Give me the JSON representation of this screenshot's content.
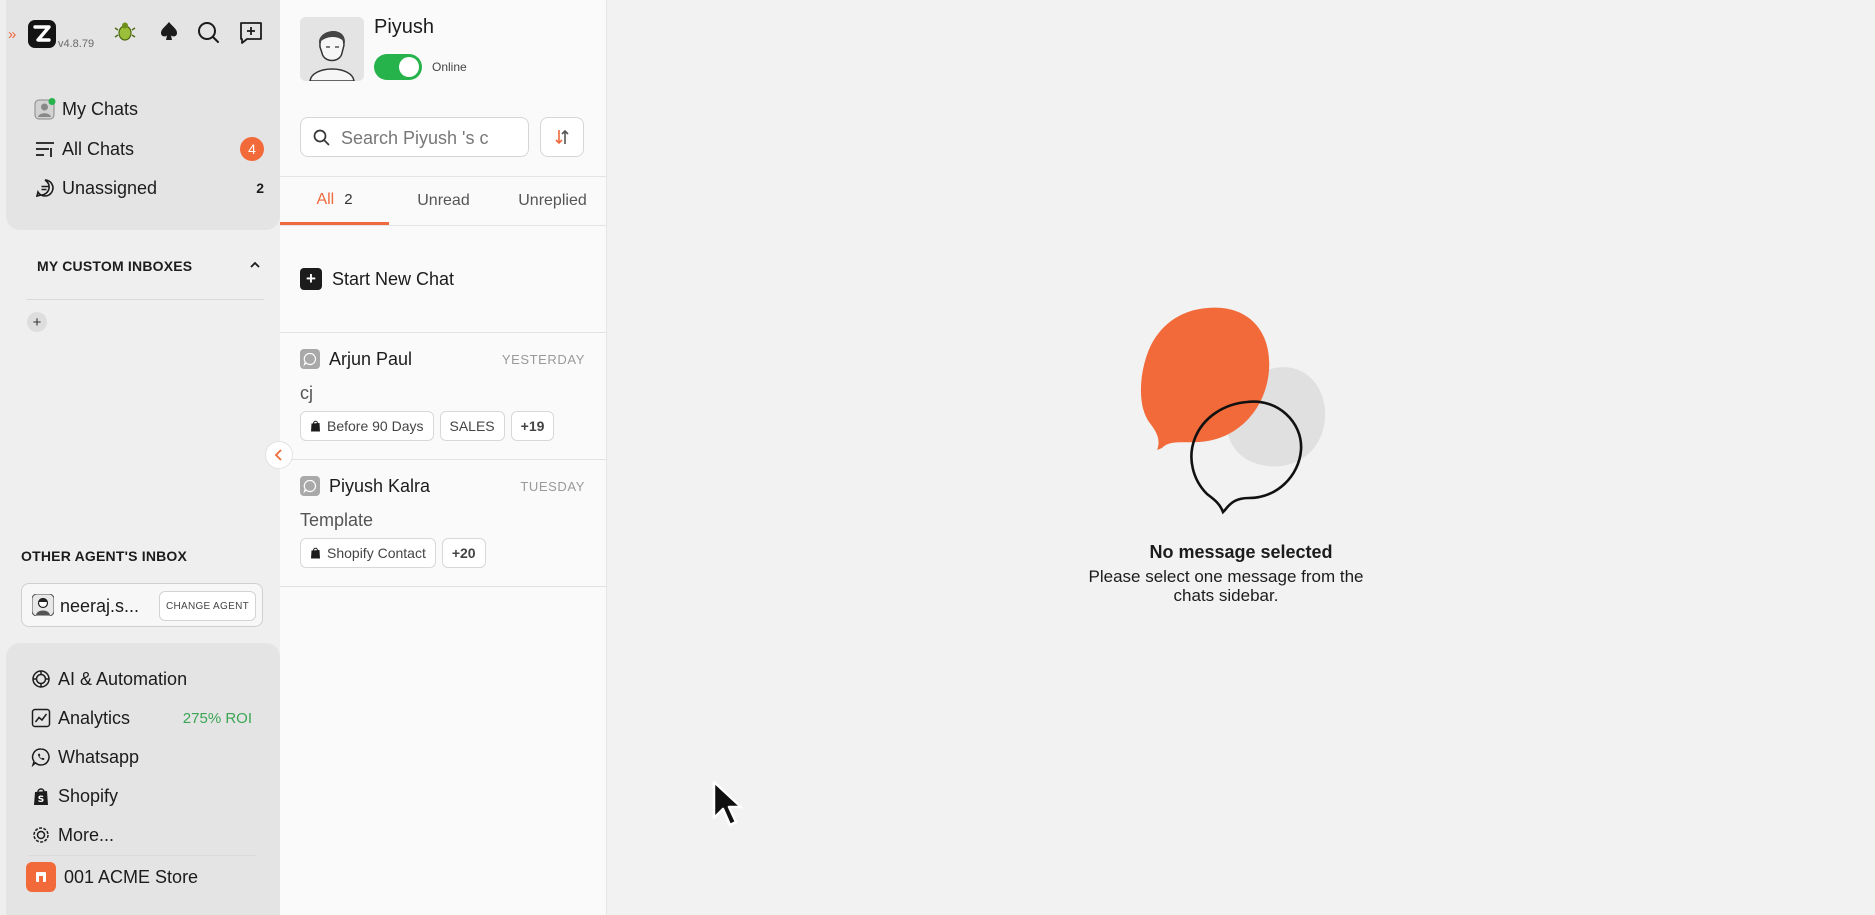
{
  "app": {
    "version": "v4.8.79"
  },
  "sidebar": {
    "nav": [
      {
        "label": "My Chats"
      },
      {
        "label": "All Chats",
        "badge": "4"
      },
      {
        "label": "Unassigned",
        "count": "2"
      }
    ],
    "custom_inboxes_title": "MY CUSTOM INBOXES",
    "add_inbox_symbol": "+",
    "other_agent_title": "OTHER AGENT'S INBOX",
    "agent": {
      "name": "neeraj.s...",
      "change_label": "CHANGE AGENT"
    },
    "bottom_nav": [
      {
        "label": "AI & Automation"
      },
      {
        "label": "Analytics",
        "extra": "275% ROI"
      },
      {
        "label": "Whatsapp"
      },
      {
        "label": "Shopify"
      },
      {
        "label": "More..."
      }
    ],
    "store": {
      "label": "001 ACME Store"
    }
  },
  "profile": {
    "name": "Piyush",
    "status": "Online",
    "online": true
  },
  "search": {
    "placeholder": "Search Piyush 's c"
  },
  "tabs": [
    {
      "label": "All",
      "count": "2",
      "active": true
    },
    {
      "label": "Unread"
    },
    {
      "label": "Unreplied"
    }
  ],
  "start_chat": {
    "label": "Start New Chat"
  },
  "chats": [
    {
      "name": "Arjun Paul",
      "time": "YESTERDAY",
      "preview": "cj",
      "tags": [
        {
          "label": "Before 90 Days",
          "icon": "shopify-icon"
        },
        {
          "label": "SALES"
        },
        {
          "label": "+19",
          "more": true
        }
      ]
    },
    {
      "name": "Piyush Kalra",
      "time": "TUESDAY",
      "preview": "Template",
      "tags": [
        {
          "label": "Shopify Contact",
          "icon": "shopify-icon"
        },
        {
          "label": "+20",
          "more": true
        }
      ]
    }
  ],
  "empty_state": {
    "title": "No message selected",
    "subtitle": "Please select one message from the chats sidebar."
  },
  "colors": {
    "accent": "#ef6a3c",
    "online": "#27b34c",
    "roi": "#3aa655"
  }
}
